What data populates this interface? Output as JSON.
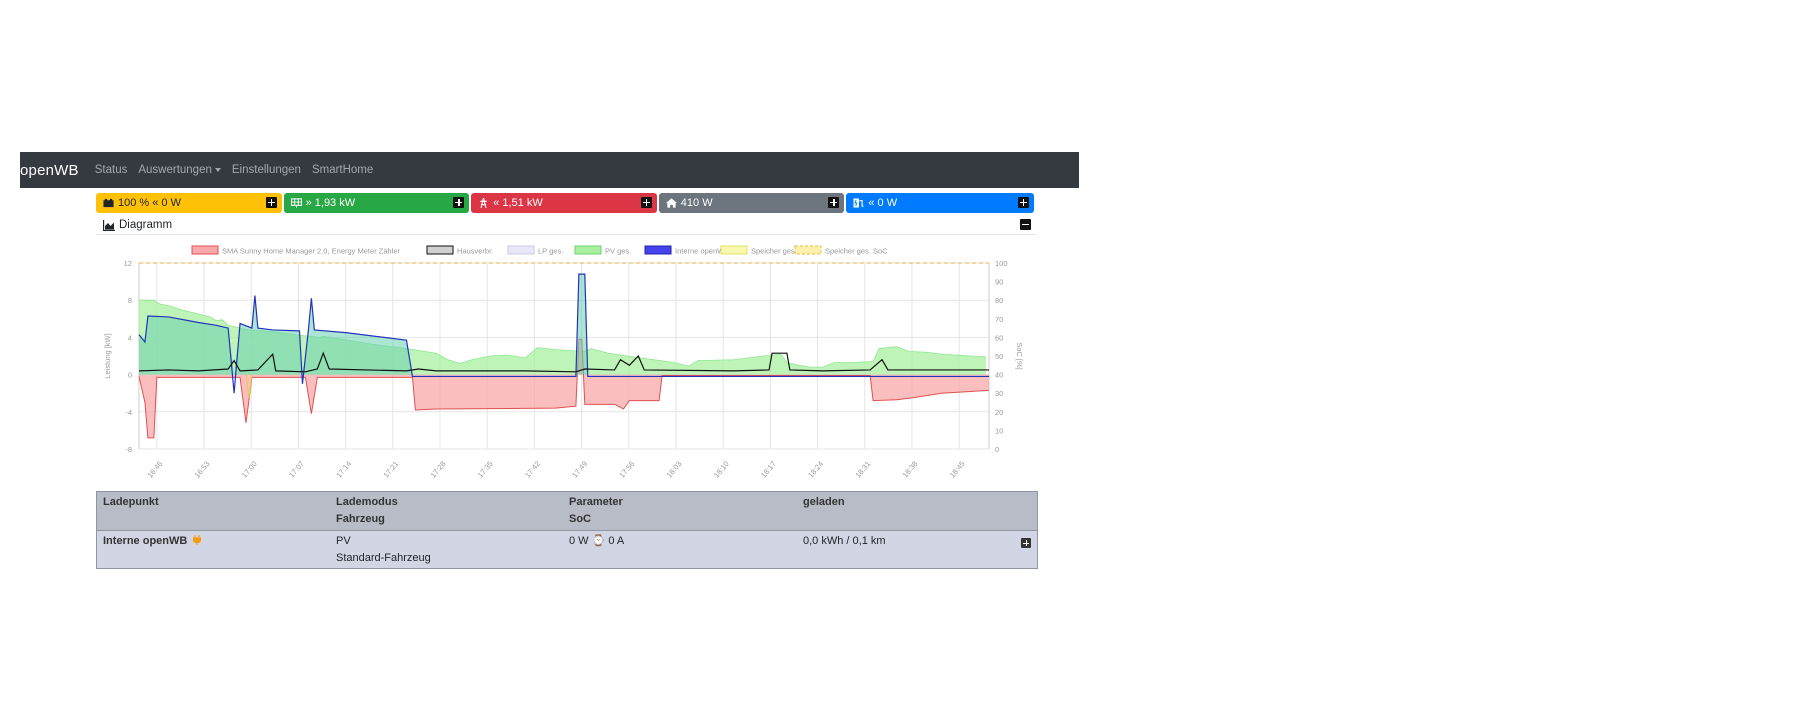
{
  "navbar": {
    "brand": "openWB",
    "items": [
      "Status",
      "Auswertungen",
      "Einstellungen",
      "SmartHome"
    ]
  },
  "cards": [
    {
      "name": "battery",
      "text": "100 % « 0 W",
      "color": "#ffc107",
      "fg": "#212529",
      "icon": "battery-icon"
    },
    {
      "name": "pv",
      "text": "» 1,93 kW",
      "color": "#28a745",
      "fg": "#ffffff",
      "icon": "solar-panel-icon"
    },
    {
      "name": "grid",
      "text": "« 1,51 kW",
      "color": "#dc3545",
      "fg": "#ffffff",
      "icon": "power-mast-icon"
    },
    {
      "name": "house",
      "text": "410 W",
      "color": "#6c757d",
      "fg": "#ffffff",
      "icon": "home-icon"
    },
    {
      "name": "charging",
      "text": "« 0 W",
      "color": "#007bff",
      "fg": "#ffffff",
      "icon": "charging-station-icon"
    }
  ],
  "diagram": {
    "title": "Diagramm"
  },
  "chart_data": {
    "type": "area",
    "legend": [
      {
        "label": "SMA Sunny Home Manager 2.0, Energy Meter Zähler",
        "color": "#f8a8a8",
        "border": "#e05050"
      },
      {
        "label": "Hausverbr.",
        "color": "#d0d0d0",
        "border": "#111111"
      },
      {
        "label": "LP ges.",
        "color": "#e8e8f8",
        "border": "#c8c8e8"
      },
      {
        "label": "PV ges.",
        "color": "#a8f0a0",
        "border": "#70d070"
      },
      {
        "label": "Interne openWB",
        "color": "#4444ee",
        "border": "#2222aa"
      },
      {
        "label": "Speicher ges.",
        "color": "#f8f8b0",
        "border": "#e0e060"
      },
      {
        "label": "Speicher ges. SoC",
        "color": "#fff0b0",
        "border": "#e0c040"
      }
    ],
    "x_ticks": [
      "16:46",
      "16:53",
      "17:00",
      "17:07",
      "17:14",
      "17:21",
      "17:28",
      "17:35",
      "17:42",
      "17:49",
      "17:56",
      "18:03",
      "18:10",
      "18:17",
      "18:24",
      "18:31",
      "18:38",
      "18:45"
    ],
    "ylabel_left": "Leistung [kW]",
    "ylabel_right": "SoC [%]",
    "y_left_ticks": [
      12,
      8,
      4,
      0,
      -4,
      -8
    ],
    "y_left_range": [
      -8,
      12
    ],
    "y_right_ticks": [
      100,
      90,
      80,
      70,
      60,
      50,
      40,
      30,
      20,
      10,
      0
    ],
    "y_right_range": [
      0,
      100
    ],
    "grid": true,
    "legend_position": "top",
    "series": {
      "pv": [
        [
          0,
          8.0
        ],
        [
          5,
          8.0
        ],
        [
          7,
          7.6
        ],
        [
          10,
          7.4
        ],
        [
          14,
          7.0
        ],
        [
          19,
          6.6
        ],
        [
          24,
          6.2
        ],
        [
          26,
          5.8
        ],
        [
          28,
          5.9
        ],
        [
          30,
          5.3
        ],
        [
          34,
          5.0
        ],
        [
          37,
          4.8
        ],
        [
          45,
          4.6
        ],
        [
          55,
          4.2
        ],
        [
          61,
          4.0
        ],
        [
          62,
          4.1
        ],
        [
          70,
          3.7
        ],
        [
          80,
          3.2
        ],
        [
          90,
          2.8
        ],
        [
          100,
          2.3
        ],
        [
          104,
          1.6
        ],
        [
          108,
          1.2
        ],
        [
          112,
          1.6
        ],
        [
          118,
          2.0
        ],
        [
          124,
          2.1
        ],
        [
          130,
          1.8
        ],
        [
          134,
          2.9
        ],
        [
          140,
          2.7
        ],
        [
          144,
          2.6
        ],
        [
          150,
          2.5
        ],
        [
          152,
          2.8
        ],
        [
          158,
          2.3
        ],
        [
          162,
          2.1
        ],
        [
          180,
          1.3
        ],
        [
          185,
          0.9
        ],
        [
          188,
          1.5
        ],
        [
          200,
          1.6
        ],
        [
          205,
          1.8
        ],
        [
          210,
          2.0
        ],
        [
          216,
          2.2
        ],
        [
          218,
          1.3
        ],
        [
          222,
          1.0
        ],
        [
          226,
          0.8
        ],
        [
          230,
          0.8
        ],
        [
          234,
          1.3
        ],
        [
          240,
          1.3
        ],
        [
          247,
          1.4
        ],
        [
          249,
          2.8
        ],
        [
          255,
          3.0
        ],
        [
          259,
          2.5
        ],
        [
          265,
          2.4
        ],
        [
          270,
          2.2
        ],
        [
          275,
          2.1
        ],
        [
          280,
          2.0
        ],
        [
          285,
          1.9
        ]
      ],
      "ev": [
        [
          0,
          4.3
        ],
        [
          2,
          3.5
        ],
        [
          3,
          6.3
        ],
        [
          10,
          6.2
        ],
        [
          20,
          5.6
        ],
        [
          26,
          5.3
        ],
        [
          30,
          5.0
        ],
        [
          32,
          -2.0
        ],
        [
          34,
          5.5
        ],
        [
          38,
          5.0
        ],
        [
          39,
          8.5
        ],
        [
          40,
          5.0
        ],
        [
          45,
          4.8
        ],
        [
          54,
          4.7
        ],
        [
          55,
          -1.0
        ],
        [
          57,
          4.8
        ],
        [
          58,
          8.2
        ],
        [
          59,
          4.8
        ],
        [
          70,
          4.5
        ],
        [
          80,
          4.1
        ],
        [
          90,
          3.7
        ],
        [
          92,
          -0.2
        ],
        [
          100,
          -0.2
        ],
        [
          147,
          -0.2
        ],
        [
          148,
          10.8
        ],
        [
          150,
          10.8
        ],
        [
          151,
          -0.2
        ],
        [
          286,
          -0.2
        ]
      ],
      "grid": [
        [
          0,
          -0.2
        ],
        [
          2,
          -3.0
        ],
        [
          3,
          -6.8
        ],
        [
          5,
          -6.8
        ],
        [
          6,
          -0.3
        ],
        [
          34,
          -0.3
        ],
        [
          36,
          -5.2
        ],
        [
          38,
          -0.3
        ],
        [
          56,
          -0.3
        ],
        [
          58,
          -4.2
        ],
        [
          60,
          -0.3
        ],
        [
          92,
          -0.3
        ],
        [
          93,
          -3.8
        ],
        [
          100,
          -3.7
        ],
        [
          140,
          -3.6
        ],
        [
          147,
          -3.4
        ],
        [
          148,
          3.8
        ],
        [
          149,
          3.8
        ],
        [
          150,
          -3.2
        ],
        [
          160,
          -3.2
        ],
        [
          163,
          -3.7
        ],
        [
          165,
          -2.8
        ],
        [
          175,
          -2.8
        ],
        [
          176,
          -0.1
        ],
        [
          246,
          -0.1
        ],
        [
          247,
          -2.8
        ],
        [
          255,
          -2.7
        ],
        [
          260,
          -2.5
        ],
        [
          270,
          -2.0
        ],
        [
          286,
          -1.7
        ]
      ],
      "house": [
        [
          0,
          0.4
        ],
        [
          10,
          0.5
        ],
        [
          20,
          0.4
        ],
        [
          30,
          0.6
        ],
        [
          32,
          1.5
        ],
        [
          34,
          0.4
        ],
        [
          40,
          0.5
        ],
        [
          45,
          2.2
        ],
        [
          46,
          0.4
        ],
        [
          56,
          0.3
        ],
        [
          60,
          0.6
        ],
        [
          62,
          2.3
        ],
        [
          64,
          0.6
        ],
        [
          90,
          0.4
        ],
        [
          94,
          0.6
        ],
        [
          100,
          0.4
        ],
        [
          130,
          0.4
        ],
        [
          147,
          0.3
        ],
        [
          150,
          0.6
        ],
        [
          160,
          0.5
        ],
        [
          162,
          1.6
        ],
        [
          165,
          1.0
        ],
        [
          168,
          2.0
        ],
        [
          170,
          0.5
        ],
        [
          200,
          0.4
        ],
        [
          212,
          0.5
        ],
        [
          213,
          2.3
        ],
        [
          218,
          2.3
        ],
        [
          219,
          0.5
        ],
        [
          230,
          0.4
        ],
        [
          246,
          0.5
        ],
        [
          250,
          1.6
        ],
        [
          252,
          0.5
        ],
        [
          286,
          0.5
        ]
      ],
      "soc": [
        [
          0,
          100
        ],
        [
          286,
          100
        ]
      ]
    }
  },
  "table": {
    "header": {
      "c1": "Ladepunkt",
      "c2a": "Lademodus",
      "c2b": "Fahrzeug",
      "c3a": "Parameter",
      "c3b": "SoC",
      "c4": "geladen"
    },
    "rows": [
      {
        "name": "Interne openWB",
        "mode": "PV",
        "vehicle": "Standard-Fahrzeug",
        "params": "0 W ⌚ 0 A",
        "charged": "0,0 kWh / 0,1 km"
      }
    ]
  }
}
